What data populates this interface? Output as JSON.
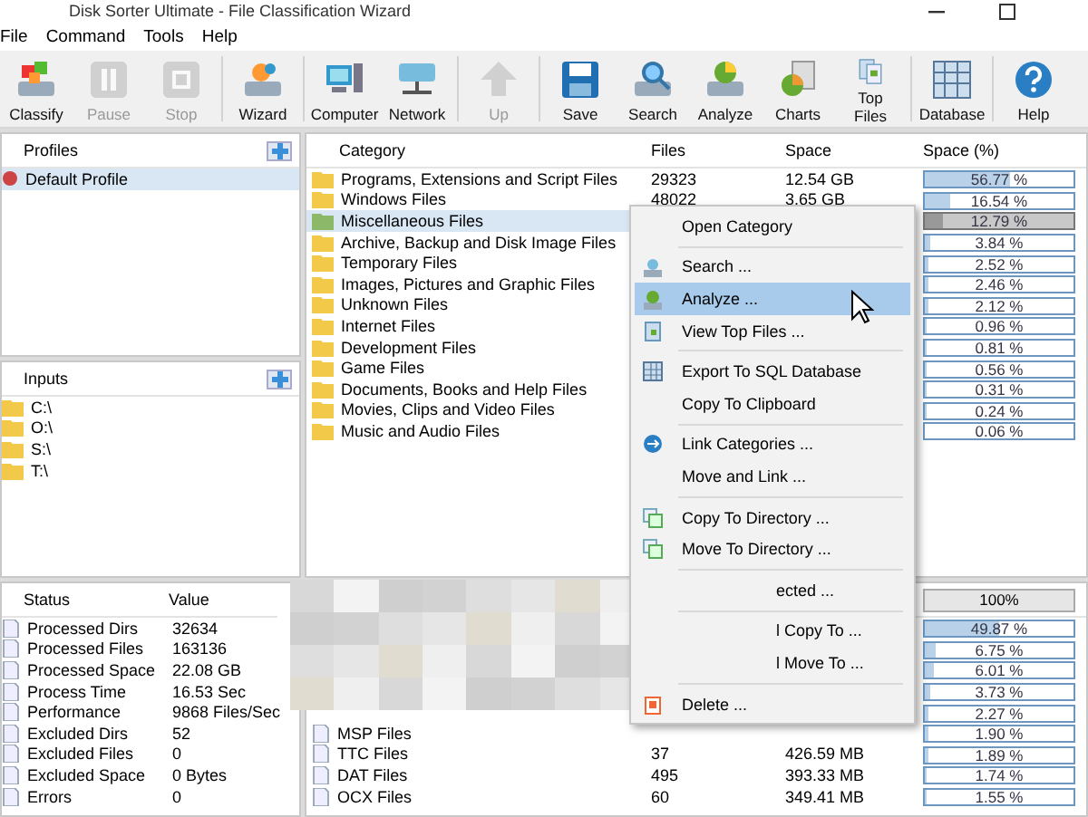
{
  "window": {
    "title": "Disk Sorter Ultimate - File Classification Wizard"
  },
  "menu_bar": [
    "File",
    "Command",
    "Tools",
    "Help"
  ],
  "toolbar_groups": [
    [
      {
        "label": "Classify",
        "disabled": false
      },
      {
        "label": "Pause",
        "disabled": true
      },
      {
        "label": "Stop",
        "disabled": true
      }
    ],
    [
      {
        "label": "Wizard",
        "disabled": false
      }
    ],
    [
      {
        "label": "Computer",
        "disabled": false
      },
      {
        "label": "Network",
        "disabled": false
      }
    ],
    [
      {
        "label": "Up",
        "disabled": true
      }
    ],
    [
      {
        "label": "Save",
        "disabled": false
      },
      {
        "label": "Search",
        "disabled": false
      },
      {
        "label": "Analyze",
        "disabled": false
      },
      {
        "label": "Charts",
        "disabled": false
      },
      {
        "label": "Top Files",
        "disabled": false
      }
    ],
    [
      {
        "label": "Database",
        "disabled": false
      }
    ],
    [
      {
        "label": "Help",
        "disabled": false
      }
    ]
  ],
  "profiles": {
    "title": "Profiles",
    "items": [
      {
        "label": "Default Profile",
        "selected": true
      }
    ]
  },
  "inputs": {
    "title": "Inputs",
    "items": [
      "C:\\",
      "O:\\",
      "S:\\",
      "T:\\"
    ]
  },
  "categories": {
    "columns": [
      "Category",
      "Files",
      "Space",
      "Space (%)"
    ],
    "rows": [
      {
        "name": "Programs, Extensions and Script Files",
        "files": "29323",
        "space": "12.54 GB",
        "percent": "56.77 %",
        "level": 0.5677,
        "selected": false
      },
      {
        "name": "Windows Files",
        "files": "48022",
        "space": "3.65 GB",
        "percent": "16.54 %",
        "level": 0.1654,
        "selected": false
      },
      {
        "name": "Miscellaneous Files",
        "percent": "12.79 %",
        "level": 0.1279,
        "selected": true
      },
      {
        "name": "Archive, Backup and Disk Image Files",
        "percent": "3.84 %",
        "level": 0.0384,
        "selected": false
      },
      {
        "name": "Temporary Files",
        "percent": "2.52 %",
        "level": 0.0252,
        "selected": false
      },
      {
        "name": "Images, Pictures and Graphic Files",
        "percent": "2.46 %",
        "level": 0.0246,
        "selected": false
      },
      {
        "name": "Unknown Files",
        "percent": "2.12 %",
        "level": 0.0212,
        "selected": false
      },
      {
        "name": "Internet Files",
        "percent": "0.96 %",
        "level": 0.0096,
        "selected": false
      },
      {
        "name": "Development Files",
        "percent": "0.81 %",
        "level": 0.0081,
        "selected": false
      },
      {
        "name": "Game Files",
        "percent": "0.56 %",
        "level": 0.0056,
        "selected": false
      },
      {
        "name": "Documents, Books and Help Files",
        "percent": "0.31 %",
        "level": 0.0031,
        "selected": false
      },
      {
        "name": "Movies, Clips and Video Files",
        "percent": "0.24 %",
        "level": 0.0024,
        "selected": false
      },
      {
        "name": "Music and Audio Files",
        "percent": "0.06 %",
        "level": 0.0006,
        "selected": false
      }
    ]
  },
  "status": {
    "columns": [
      "Status",
      "Value"
    ],
    "rows": [
      {
        "name": "Processed Dirs",
        "value": "32634"
      },
      {
        "name": "Processed Files",
        "value": "163136"
      },
      {
        "name": "Processed Space",
        "value": "22.08 GB"
      },
      {
        "name": "Process Time",
        "value": "16.53 Sec"
      },
      {
        "name": "Performance",
        "value": "9868 Files/Sec"
      },
      {
        "name": "Excluded Dirs",
        "value": "52"
      },
      {
        "name": "Excluded Files",
        "value": "0"
      },
      {
        "name": "Excluded Space",
        "value": "0 Bytes"
      },
      {
        "name": "Errors",
        "value": "0"
      }
    ]
  },
  "file_types": {
    "percent_header": "100%",
    "rows": [
      {
        "percent": "49.87 %",
        "level": 0.4987
      },
      {
        "percent": "6.75 %",
        "level": 0.0675
      },
      {
        "percent": "6.01 %",
        "level": 0.0601
      },
      {
        "percent": "3.73 %",
        "level": 0.0373
      },
      {
        "percent": "2.27 %",
        "level": 0.0227
      },
      {
        "name": "MSP Files",
        "percent": "1.90 %",
        "level": 0.019
      },
      {
        "name": "TTC Files",
        "files": "37",
        "space": "426.59 MB",
        "percent": "1.89 %",
        "level": 0.0189
      },
      {
        "name": "DAT Files",
        "files": "495",
        "space": "393.33 MB",
        "percent": "1.74 %",
        "level": 0.0174
      },
      {
        "name": "OCX Files",
        "files": "60",
        "space": "349.41 MB",
        "percent": "1.55 %",
        "level": 0.0155
      }
    ]
  },
  "context_menu": [
    {
      "kind": "item",
      "label": "Open Category",
      "selected": false
    },
    {
      "kind": "separator"
    },
    {
      "kind": "item",
      "label": "Search ...",
      "selected": false
    },
    {
      "kind": "item",
      "label": "Analyze ...",
      "selected": true
    },
    {
      "kind": "item",
      "label": "View Top Files ...",
      "selected": false
    },
    {
      "kind": "separator"
    },
    {
      "kind": "item",
      "label": "Export To SQL Database",
      "selected": false
    },
    {
      "kind": "item",
      "label": "Copy To Clipboard",
      "selected": false
    },
    {
      "kind": "separator"
    },
    {
      "kind": "item",
      "label": "Link Categories ...",
      "selected": false
    },
    {
      "kind": "item",
      "label": "Move and Link ...",
      "selected": false
    },
    {
      "kind": "separator"
    },
    {
      "kind": "item",
      "label": "Copy To Directory ...",
      "selected": false
    },
    {
      "kind": "item",
      "label": "Move To Directory ...",
      "selected": false
    },
    {
      "kind": "separator"
    },
    {
      "kind": "covered_item",
      "label": "ected ...",
      "selected": false
    },
    {
      "kind": "separator"
    },
    {
      "kind": "covered_item",
      "label": "l Copy To ...",
      "selected": false
    },
    {
      "kind": "covered_item",
      "label": "l Move To ...",
      "selected": false
    },
    {
      "kind": "separator"
    },
    {
      "kind": "item",
      "label": "Delete ...",
      "selected": false
    }
  ]
}
